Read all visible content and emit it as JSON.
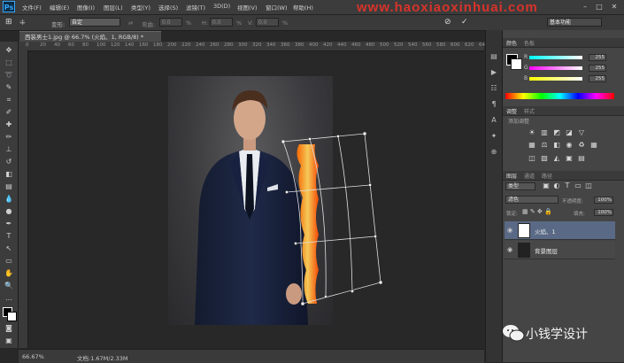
{
  "app": {
    "logo": "Ps"
  },
  "menu": {
    "items": [
      "文件(F)",
      "编辑(E)",
      "图像(I)",
      "图层(L)",
      "类型(Y)",
      "选择(S)",
      "滤镜(T)",
      "3D(D)",
      "视图(V)",
      "窗口(W)",
      "帮助(H)"
    ]
  },
  "options_bar": {
    "transform_label": "变形:",
    "transform_value": "自定",
    "bend_label": "弯曲:",
    "bend_value": "0.0",
    "bend_unit": "%",
    "h_label": "H:",
    "h_value": "0.0",
    "h_unit": "%",
    "v_label": "V:",
    "v_value": "0.0",
    "v_unit": "%",
    "workspace_label": "基本功能",
    "watermark_url": "www.haoxiaoxinhuai.com"
  },
  "document_tab": {
    "title": "西装男士1.jpg @ 66.7% (火焰、1, RGB/8) *"
  },
  "ruler_ticks": [
    "0",
    "20",
    "40",
    "60",
    "80",
    "100",
    "120",
    "140",
    "160",
    "180",
    "200",
    "220",
    "240",
    "260",
    "280",
    "300",
    "320",
    "340",
    "360",
    "380",
    "400",
    "420",
    "440",
    "460",
    "480",
    "500",
    "520",
    "540",
    "560",
    "580",
    "600",
    "620",
    "640"
  ],
  "status": {
    "zoom": "66.67%",
    "doc_size": "文档:1.67M/2.33M"
  },
  "color_panel": {
    "tabs": [
      "颜色",
      "色板"
    ],
    "channels": [
      {
        "label": "R",
        "value": "255",
        "color": "#ff4040"
      },
      {
        "label": "G",
        "value": "255",
        "color": "#40ff40"
      },
      {
        "label": "B",
        "value": "255",
        "color": "#4070ff"
      }
    ]
  },
  "adjustments_panel": {
    "tabs": [
      "调整",
      "样式"
    ],
    "subtitle": "添加调整"
  },
  "layers_panel": {
    "tabs": [
      "图层",
      "通道",
      "路径"
    ],
    "kind_label": "类型",
    "blend_mode": "滤色",
    "opacity_label": "不透明度:",
    "opacity_value": "100%",
    "lock_label": "锁定:",
    "fill_label": "填充:",
    "fill_value": "100%",
    "layers": [
      {
        "name": "火焰、1",
        "selected": true
      },
      {
        "name": "背景图层",
        "selected": false
      }
    ]
  },
  "watermark": {
    "text": "小钱学设计"
  }
}
